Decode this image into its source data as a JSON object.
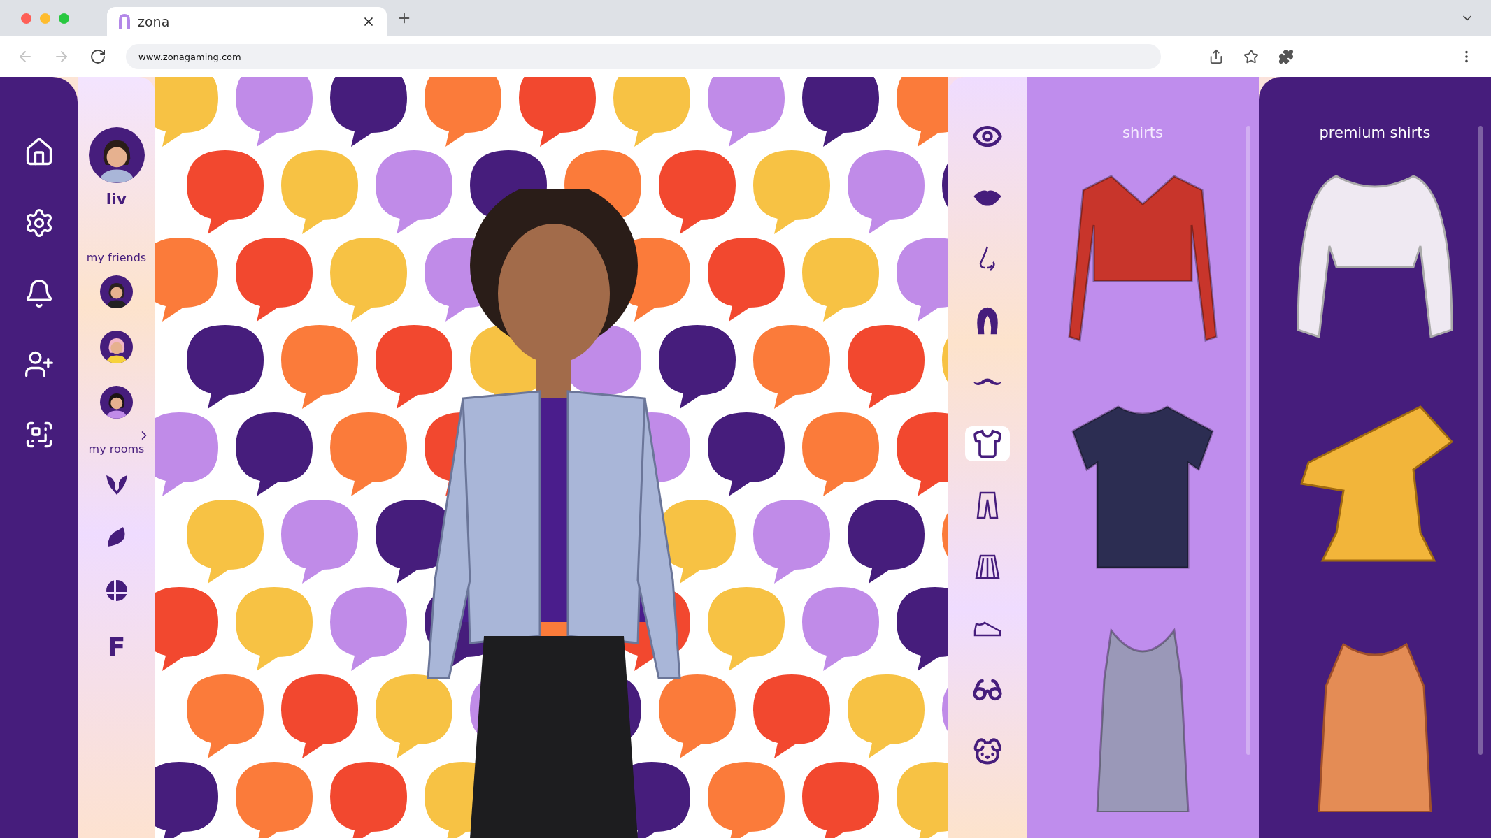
{
  "browser": {
    "tab_title": "zona",
    "url": "www.zonagaming.com"
  },
  "nav": [
    {
      "kind": "home"
    },
    {
      "kind": "settings"
    },
    {
      "kind": "bell"
    },
    {
      "kind": "add-user"
    },
    {
      "kind": "qr"
    }
  ],
  "profile": {
    "name": "liv"
  },
  "friends": {
    "title": "my friends",
    "items": [
      {
        "kind": "short-hair"
      },
      {
        "kind": "pink-hair"
      },
      {
        "kind": "long-hair"
      }
    ]
  },
  "rooms": {
    "title": "my rooms",
    "items": [
      {
        "kind": "destiny"
      },
      {
        "kind": "leaf"
      },
      {
        "kind": "smash"
      },
      {
        "kind": "letter",
        "text": "F"
      }
    ]
  },
  "categories": [
    {
      "kind": "eye",
      "selected": false
    },
    {
      "kind": "lips",
      "selected": false
    },
    {
      "kind": "nose",
      "selected": false
    },
    {
      "kind": "hair",
      "selected": false
    },
    {
      "kind": "mustache",
      "selected": false
    },
    {
      "kind": "shirt",
      "selected": true
    },
    {
      "kind": "pants",
      "selected": false
    },
    {
      "kind": "skirt",
      "selected": false
    },
    {
      "kind": "shoe",
      "selected": false
    },
    {
      "kind": "glasses",
      "selected": false
    },
    {
      "kind": "dog",
      "selected": false
    }
  ],
  "shirts": {
    "title": "shirts",
    "items": [
      {
        "kind": "wrap-top",
        "color": "#c8352b"
      },
      {
        "kind": "tshirt",
        "color": "#2c2d52"
      },
      {
        "kind": "tank",
        "color": "#9a98b8"
      }
    ]
  },
  "premium_shirts": {
    "title": "premium shirts",
    "items": [
      {
        "kind": "blouse",
        "color": "#efe9f2"
      },
      {
        "kind": "ruffle",
        "color": "#f2b53a"
      },
      {
        "kind": "vest",
        "color": "#e48c55"
      }
    ]
  }
}
